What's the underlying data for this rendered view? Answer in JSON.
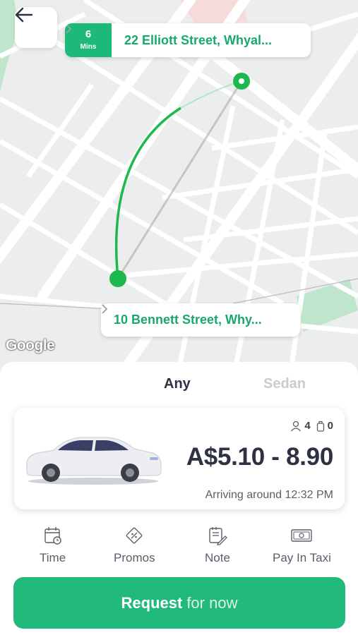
{
  "header": {
    "back_icon": "arrow-left-icon"
  },
  "destination": {
    "eta_value": "6",
    "eta_unit": "Mins",
    "address": "22 Elliott Street, Whyal...",
    "chevron_icon": "chevron-right-icon"
  },
  "pickup": {
    "address": "10 Bennett Street, Why...",
    "chevron_icon": "chevron-right-icon"
  },
  "map": {
    "attribution": "Google",
    "route_color": "#1db94e"
  },
  "tabs": [
    {
      "label": "Any",
      "active": true
    },
    {
      "label": "Sedan",
      "active": false
    }
  ],
  "ride_card": {
    "passengers": "4",
    "luggage": "0",
    "price": "A$5.10 - 8.90",
    "arrival": "Arriving around 12:32 PM"
  },
  "options": [
    {
      "label": "Time",
      "icon": "calendar-clock-icon"
    },
    {
      "label": "Promos",
      "icon": "promo-ticket-icon"
    },
    {
      "label": "Note",
      "icon": "note-pencil-icon"
    },
    {
      "label": "Pay In Taxi",
      "icon": "cash-icon"
    }
  ],
  "request": {
    "label_strong": "Request",
    "label_rest": "for now"
  },
  "colors": {
    "brand_green": "#22b97c",
    "text_dark": "#2d3142"
  }
}
